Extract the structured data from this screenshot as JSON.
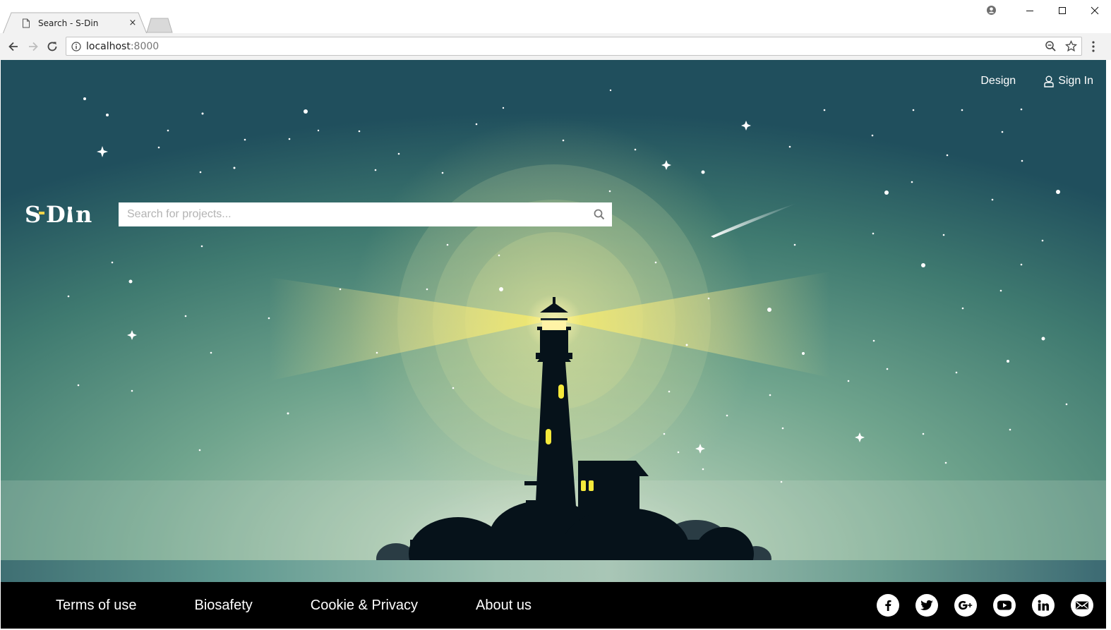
{
  "browser": {
    "tab_title": "Search - S-Din",
    "tab_close": "×",
    "url_host": "localhost",
    "url_port": ":8000"
  },
  "page": {
    "nav": {
      "design": "Design",
      "sign_in": "Sign In"
    },
    "logo": "S-Din",
    "search": {
      "placeholder": "Search for projects..."
    },
    "footer": {
      "links": [
        "Terms of use",
        "Biosafety",
        "Cookie & Privacy",
        "About us"
      ],
      "social_icons": [
        "facebook-icon",
        "twitter-icon",
        "google-plus-icon",
        "youtube-icon",
        "linkedin-icon",
        "email-icon"
      ]
    }
  },
  "colors": {
    "accent_light": "#e8e37a",
    "window_glow": "#f5e93b",
    "silhouette": "#06121a",
    "footer_bg": "#000000"
  }
}
